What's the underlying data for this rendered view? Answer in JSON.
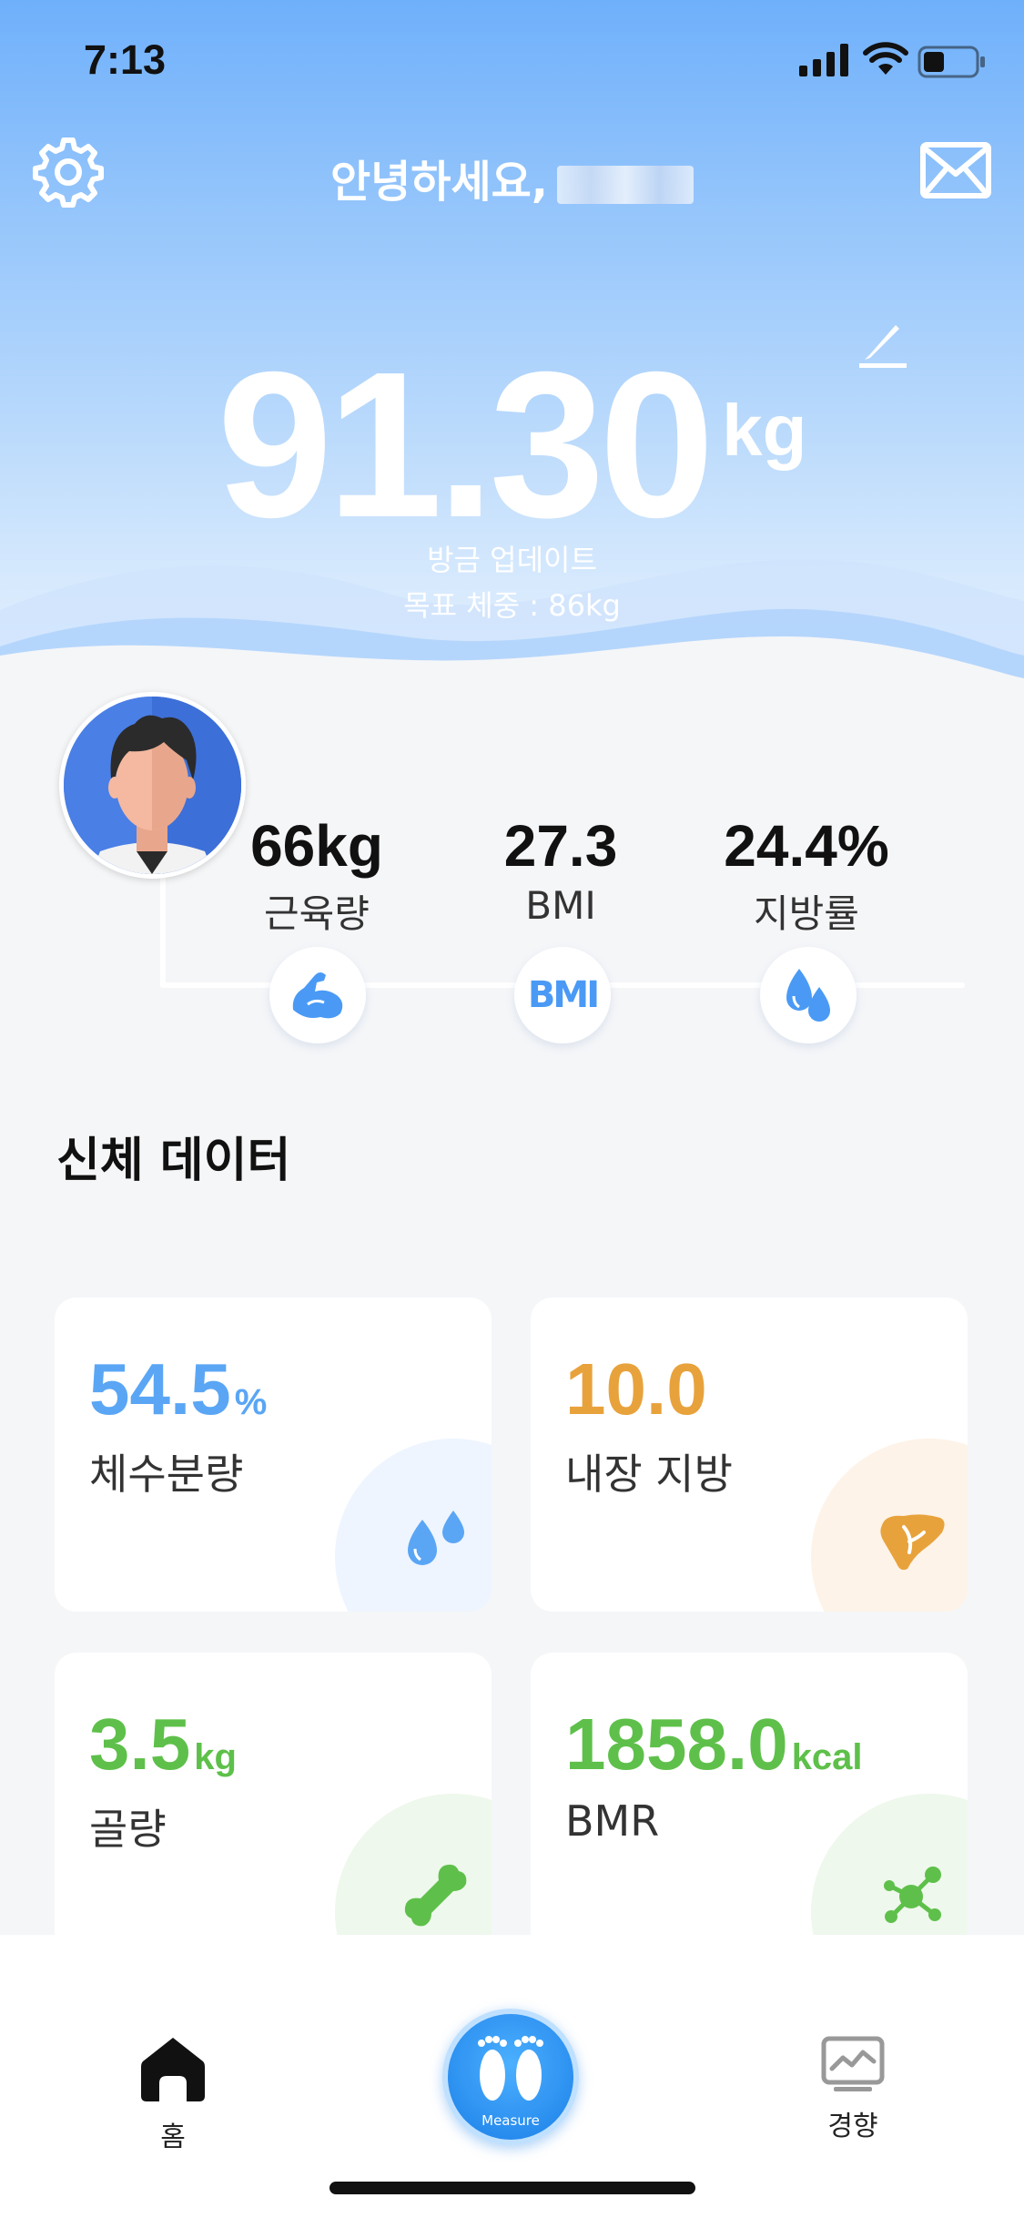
{
  "status_bar": {
    "time": "7:13"
  },
  "header": {
    "greeting": "안녕하세요,",
    "weight_value": "91.30",
    "weight_unit": "kg",
    "updated_text": "방금 업데이트",
    "goal_text": "목표 체중 : 86kg"
  },
  "metrics": [
    {
      "value": "66kg",
      "label": "근육량",
      "icon": "muscle-arm-icon"
    },
    {
      "value": "27.3",
      "label": "BMI",
      "icon": "bmi-icon",
      "icon_text": "BMI"
    },
    {
      "value": "24.4%",
      "label": "지방률",
      "icon": "fat-drops-icon"
    }
  ],
  "section": {
    "title": "신체 데이터"
  },
  "cards": [
    {
      "value": "54.5",
      "unit": "%",
      "label": "체수분량",
      "color": "#5aa6f5",
      "icon": "water-drops-icon"
    },
    {
      "value": "10.0",
      "unit": "",
      "label": "내장 지방",
      "color": "#e8a23c",
      "icon": "liver-icon"
    },
    {
      "value": "3.5",
      "unit": "kg",
      "label": "골량",
      "color": "#5ec04a",
      "icon": "bone-icon"
    },
    {
      "value": "1858.0",
      "unit": "kcal",
      "label": "BMR",
      "color": "#5ec04a",
      "icon": "molecule-icon"
    }
  ],
  "tabbar": {
    "home_label": "홈",
    "measure_label": "Measure",
    "trend_label": "경향"
  },
  "colors": {
    "header_top": "#6fb0fb",
    "accent_blue": "#1b7fe8",
    "water": "#5aa6f5",
    "visceral": "#e8a23c",
    "green": "#5ec04a"
  }
}
